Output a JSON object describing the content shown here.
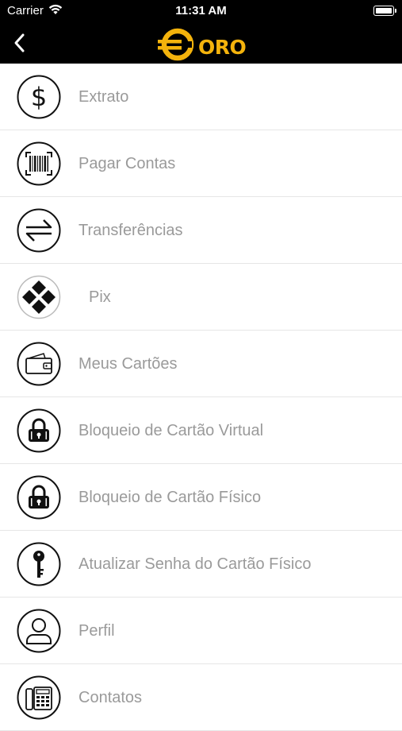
{
  "status_bar": {
    "carrier": "Carrier",
    "time": "11:31 AM"
  },
  "nav": {
    "back_icon": "chevron-left-icon",
    "logo_text": "ORO",
    "logo_color": "#f4b30c"
  },
  "menu": {
    "items": [
      {
        "label": "Extrato",
        "icon": "dollar-sign-icon"
      },
      {
        "label": "Pagar Contas",
        "icon": "barcode-icon"
      },
      {
        "label": "Transferências",
        "icon": "transfer-arrows-icon"
      },
      {
        "label": "Pix",
        "icon": "pix-icon"
      },
      {
        "label": "Meus Cartões",
        "icon": "wallet-icon"
      },
      {
        "label": "Bloqueio de Cartão Virtual",
        "icon": "lock-icon"
      },
      {
        "label": "Bloqueio de Cartão Físico",
        "icon": "lock-icon"
      },
      {
        "label": "Atualizar Senha do Cartão Físico",
        "icon": "key-icon"
      },
      {
        "label": "Perfil",
        "icon": "user-icon"
      },
      {
        "label": "Contatos",
        "icon": "phone-icon"
      }
    ]
  },
  "colors": {
    "label_gray": "#9a9a9a",
    "divider": "#e6e6e6",
    "nav_background": "#000000"
  }
}
